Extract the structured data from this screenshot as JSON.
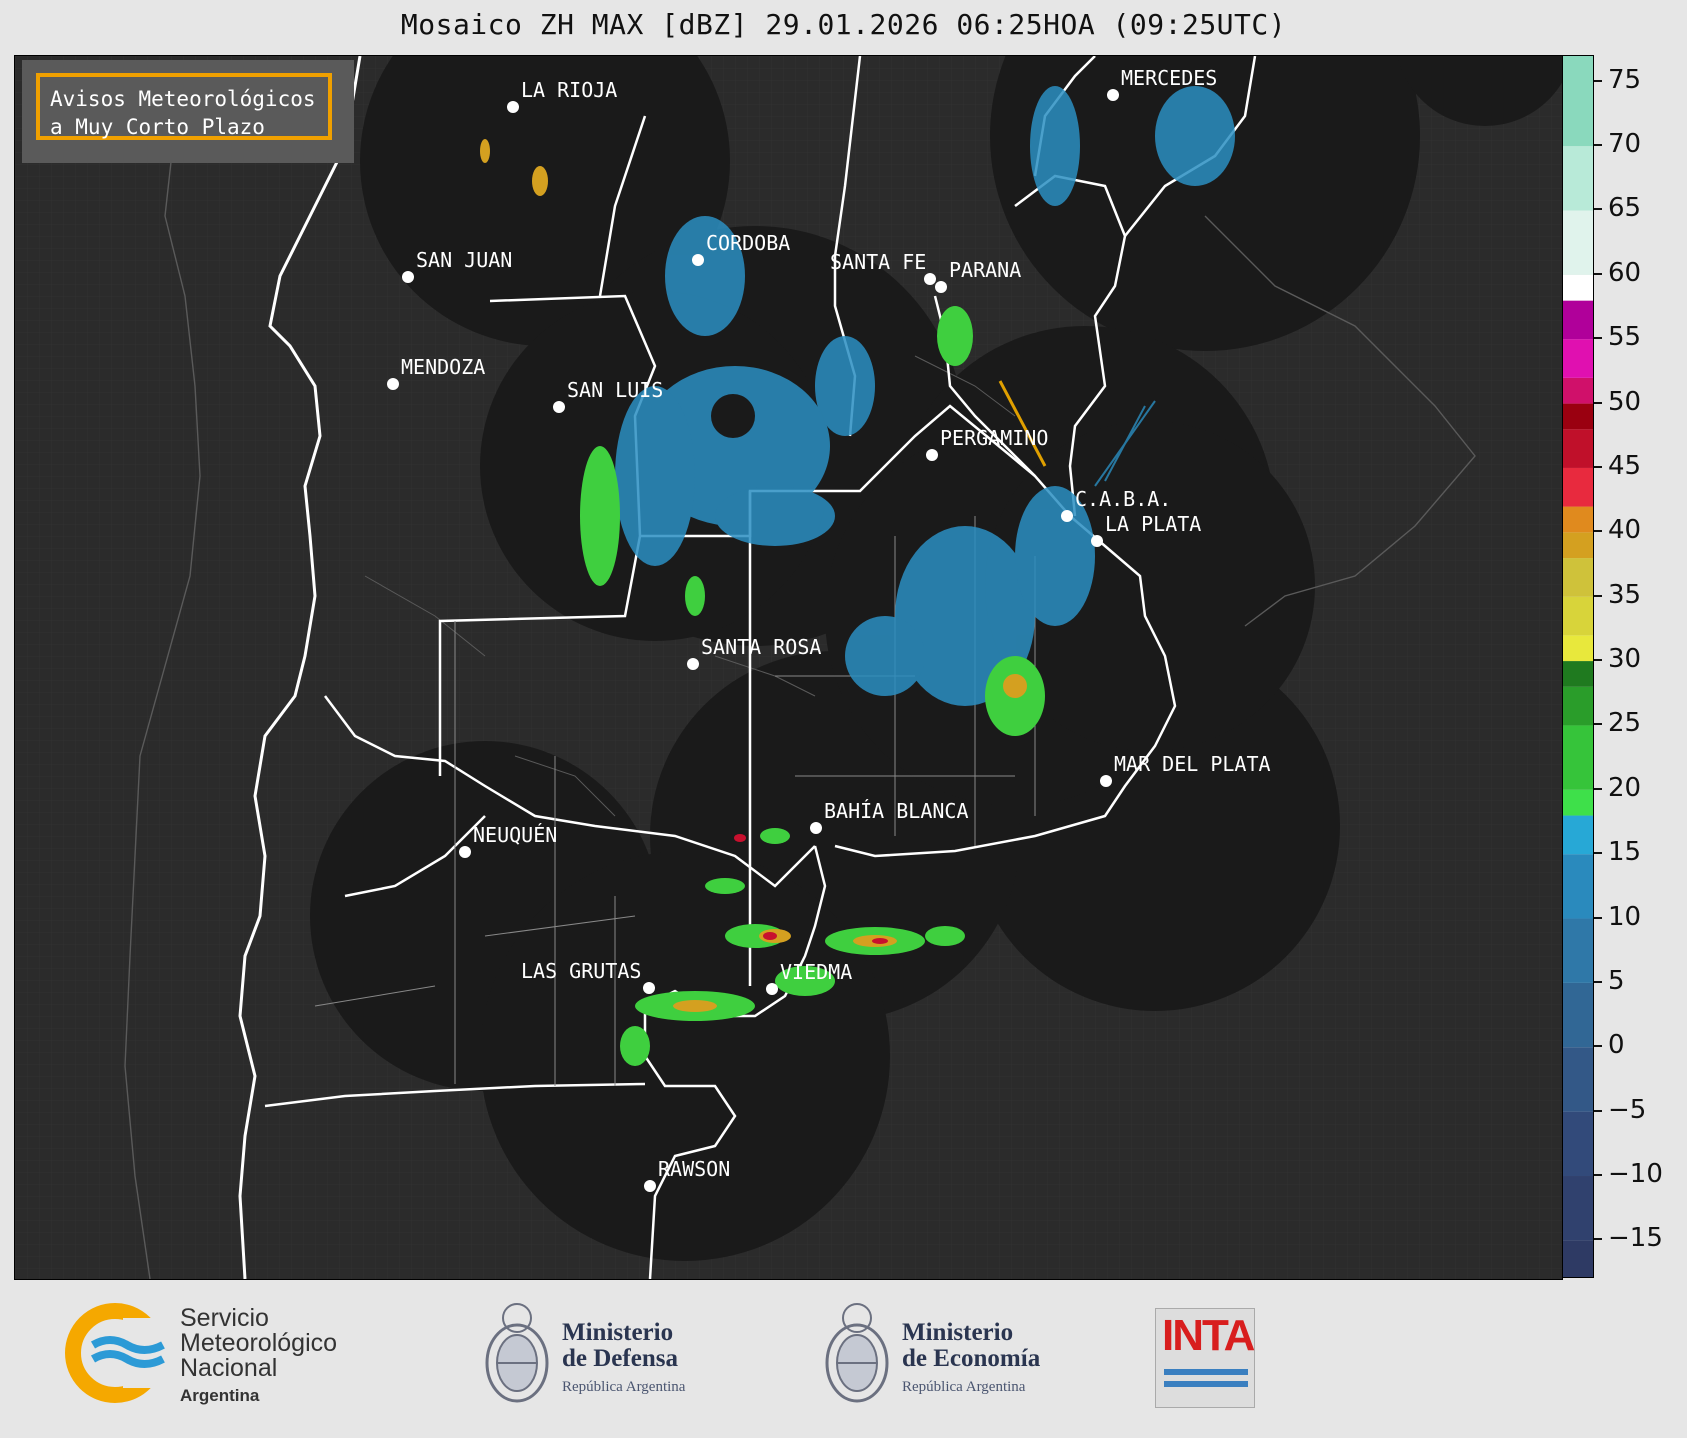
{
  "title": "Mosaico ZH MAX [dBZ] 29.01.2026 06:25HOA (09:25UTC)",
  "notice": {
    "line1": "Avisos Meteorológicos",
    "line2": "a Muy Corto Plazo"
  },
  "colors": {
    "map_background": "#2b2b2b",
    "radar_coverage": "#1a1a1a",
    "borders": "#ffffff",
    "notice_border": "#f0a000"
  },
  "colorbar": {
    "unit": "dBZ",
    "range": [
      -18,
      77
    ],
    "ticks": [
      "75",
      "70",
      "65",
      "60",
      "55",
      "50",
      "45",
      "40",
      "35",
      "30",
      "25",
      "20",
      "15",
      "10",
      "5",
      "0",
      "−5",
      "−10",
      "−15"
    ]
  },
  "cities": [
    {
      "name": "LA RIOJA"
    },
    {
      "name": "MERCEDES"
    },
    {
      "name": "CORDOBA"
    },
    {
      "name": "SAN JUAN"
    },
    {
      "name": "SANTA FE"
    },
    {
      "name": "PARANA"
    },
    {
      "name": "MENDOZA"
    },
    {
      "name": "SAN LUIS"
    },
    {
      "name": "PERGAMINO"
    },
    {
      "name": "C.A.B.A."
    },
    {
      "name": "LA PLATA"
    },
    {
      "name": "SANTA ROSA"
    },
    {
      "name": "MAR DEL PLATA"
    },
    {
      "name": "BAHÍA BLANCA"
    },
    {
      "name": "NEUQUÉN"
    },
    {
      "name": "LAS GRUTAS"
    },
    {
      "name": "VIEDMA"
    },
    {
      "name": "RAWSON"
    }
  ],
  "logos": {
    "smn": {
      "line1": "Servicio",
      "line2": "Meteorológico",
      "line3": "Nacional",
      "country": "Argentina"
    },
    "defensa": {
      "line1": "Ministerio",
      "line2": "de Defensa",
      "sub": "República Argentina"
    },
    "economia": {
      "line1": "Ministerio",
      "line2": "de Economía",
      "sub": "República Argentina"
    },
    "inta": {
      "text": "INTA"
    }
  }
}
